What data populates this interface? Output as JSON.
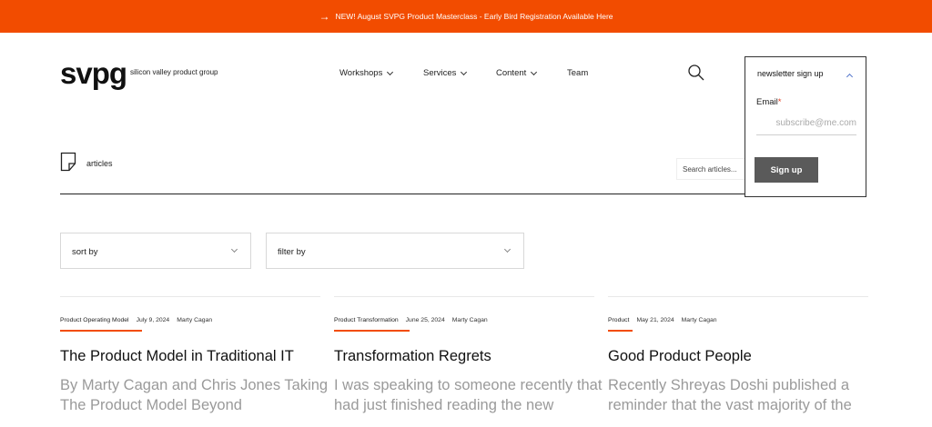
{
  "banner": {
    "arrow": "→",
    "text": "NEW! August SVPG Product Masterclass - Early Bird Registration Available Here"
  },
  "header": {
    "logo": "svpg",
    "tagline": "silicon valley product group",
    "nav": [
      {
        "label": "Workshops",
        "has_dropdown": true
      },
      {
        "label": "Services",
        "has_dropdown": true
      },
      {
        "label": "Content",
        "has_dropdown": true
      },
      {
        "label": "Team",
        "has_dropdown": false
      }
    ],
    "search_icon": "search-icon"
  },
  "newsletter": {
    "title": "newsletter sign up",
    "expanded": true,
    "email_label": "Email",
    "required_marker": "*",
    "email_placeholder": "subscribe@me.com",
    "email_value": "",
    "signup_label": "Sign up"
  },
  "section": {
    "icon": "document-icon",
    "label": "articles",
    "search_placeholder": "Search articles..."
  },
  "filters": {
    "sort_label": "sort by",
    "filter_label": "filter by"
  },
  "articles": [
    {
      "category": "Product Operating Model",
      "date": "July 9, 2024",
      "author": "Marty Cagan",
      "title": "The Product Model in Traditional IT",
      "excerpt": "By Marty Cagan and Chris Jones Taking The Product Model Beyond"
    },
    {
      "category": "Product Transformation",
      "date": "June 25, 2024",
      "author": "Marty Cagan",
      "title": "Transformation Regrets",
      "excerpt": "I was speaking to someone recently that had just finished reading the new"
    },
    {
      "category": "Product",
      "date": "May 21, 2024",
      "author": "Marty Cagan",
      "title": "Good Product People",
      "excerpt": "Recently Shreyas Doshi published a reminder that the vast majority of the"
    }
  ],
  "colors": {
    "accent": "#f24c00",
    "button": "#5a5a5a",
    "excerpt": "#9a9a9a"
  }
}
